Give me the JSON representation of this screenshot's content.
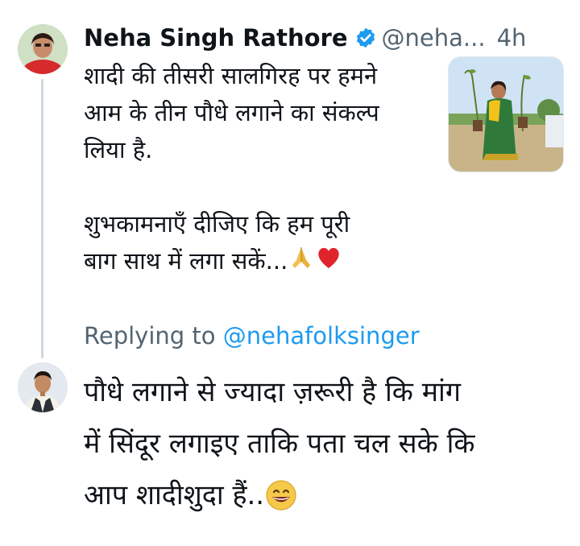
{
  "tweet": {
    "author_name": "Neha Singh Rathore",
    "author_handle": "@neha...",
    "timestamp": "4h",
    "text_lines": "शादी की तीसरी सालगिरह पर हमने\nआम के तीन पौधे लगाने का संकल्प\nलिया है.\n\nशुभकामनाएँ दीजिए कि हम पूरी\nबाग साथ में लगा सकें...",
    "emojis": [
      "folded-hands",
      "red-heart"
    ]
  },
  "reply": {
    "replying_to_label": "Replying to",
    "replying_to_handle": "@nehafolksinger",
    "text": "पौधे लगाने से ज्यादा ज़रूरी है कि मांग\nमें सिंदूर लगाइए ताकि पता चल सके कि\nआप शादीशुदा हैं..",
    "emoji": "grinning-face"
  },
  "colors": {
    "verified": "#1d9bf0",
    "mention": "#1d9bf0",
    "secondary_text": "#536471",
    "thread_line": "#cfd9de"
  }
}
